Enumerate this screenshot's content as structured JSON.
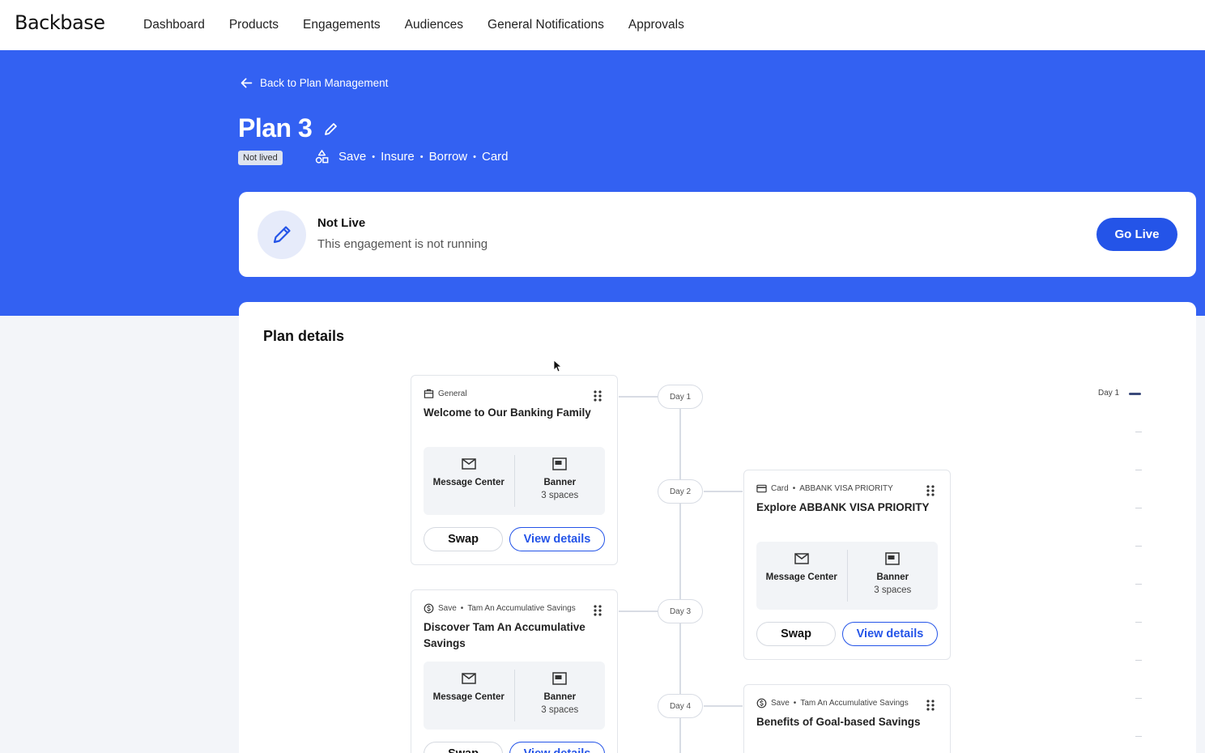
{
  "brand": {
    "logo": "Backbase"
  },
  "nav": {
    "items": [
      "Dashboard",
      "Products",
      "Engagements",
      "Audiences",
      "General Notifications",
      "Approvals"
    ]
  },
  "header": {
    "back_label": "Back to Plan Management",
    "title": "Plan 3",
    "badge": "Not lived",
    "products": [
      "Save",
      "Insure",
      "Borrow",
      "Card"
    ]
  },
  "status": {
    "title": "Not Live",
    "subtitle": "This engagement is not running",
    "action_label": "Go Live"
  },
  "plan": {
    "title": "Plan details",
    "days": [
      "Day 1",
      "Day 2",
      "Day 3",
      "Day 4"
    ],
    "cards": [
      {
        "category": "General",
        "product": "",
        "title": "Welcome to Our Banking Family",
        "channels": [
          {
            "name": "Message Center",
            "sub": ""
          },
          {
            "name": "Banner",
            "sub": "3 spaces"
          }
        ],
        "swap_label": "Swap",
        "view_label": "View details"
      },
      {
        "category": "Card",
        "product": "ABBANK VISA PRIORITY",
        "title": "Explore ABBANK VISA PRIORITY",
        "channels": [
          {
            "name": "Message Center",
            "sub": ""
          },
          {
            "name": "Banner",
            "sub": "3 spaces"
          }
        ],
        "swap_label": "Swap",
        "view_label": "View details"
      },
      {
        "category": "Save",
        "product": "Tam An Accumulative Savings",
        "title": "Discover Tam An Accumulative Savings",
        "channels": [
          {
            "name": "Message Center",
            "sub": ""
          },
          {
            "name": "Banner",
            "sub": "3 spaces"
          }
        ],
        "swap_label": "Swap",
        "view_label": "View details"
      },
      {
        "category": "Save",
        "product": "Tam An Accumulative Savings",
        "title": "Benefits of Goal-based Savings"
      }
    ]
  },
  "minimap": {
    "active_label": "Day 1"
  },
  "colors": {
    "brand_blue": "#3361f2",
    "button_blue": "#2454e8"
  }
}
